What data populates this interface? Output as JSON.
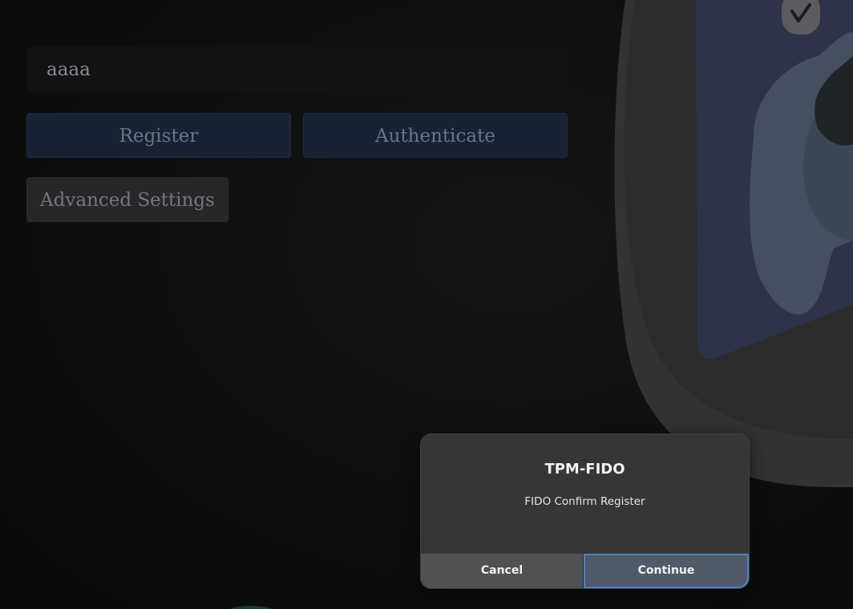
{
  "background_page": {
    "input_value": "aaaa",
    "register_label": "Register",
    "authenticate_label": "Authenticate",
    "advanced_settings_label": "Advanced Settings"
  },
  "dialog": {
    "title": "TPM-FIDO",
    "message": "FIDO Confirm Register",
    "cancel_label": "Cancel",
    "continue_label": "Continue"
  },
  "colors": {
    "dialog_bg": "#353637",
    "focus_ring": "#4f80c4",
    "button_blue": "#182234"
  },
  "icons": {
    "decoration": "checkmark-icon"
  }
}
